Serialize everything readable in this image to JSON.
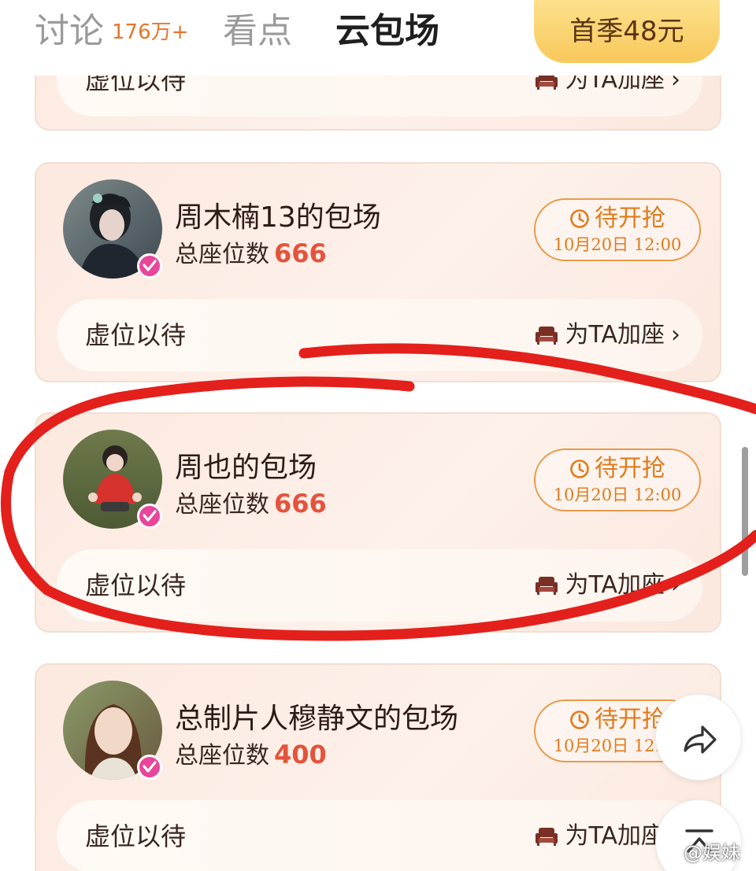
{
  "tabs": {
    "discuss_label": "讨论",
    "discuss_count": "176万+",
    "highlights_label": "看点",
    "cloud_label": "云包场"
  },
  "season_button": {
    "label": "首季48元"
  },
  "cards": [
    {
      "host": "",
      "seats_label": "",
      "seats": "",
      "wait_label": "虚位以待",
      "add_seat_label": "为TA加座"
    },
    {
      "host": "周木楠13的包场",
      "seats_label": "总座位数",
      "seats": "666",
      "status": "待开抢",
      "time": "10月20日 12:00",
      "wait_label": "虚位以待",
      "add_seat_label": "为TA加座"
    },
    {
      "host": "周也的包场",
      "seats_label": "总座位数",
      "seats": "666",
      "status": "待开抢",
      "time": "10月20日 12:00",
      "wait_label": "虚位以待",
      "add_seat_label": "为TA加座"
    },
    {
      "host": "总制片人穆静文的包场",
      "seats_label": "总座位数",
      "seats": "400",
      "status": "待开抢",
      "time": "10月20日 12:00",
      "wait_label": "虚位以待",
      "add_seat_label": "为TA加座"
    }
  ],
  "icons": {
    "seat": "armchair-icon",
    "clock": "clock-icon",
    "verify": "verified-badge-icon",
    "share": "share-arrow-icon",
    "top": "back-to-top-icon"
  },
  "colors": {
    "accent_orange": "#e07b1c",
    "seat_number_red": "#e4533c",
    "annotation_red": "#e3201b",
    "verify_pink": "#e8459b"
  },
  "watermark": {
    "text": "@娱妹一"
  }
}
